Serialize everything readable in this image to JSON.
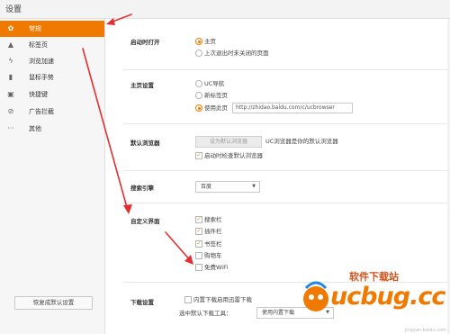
{
  "window": {
    "title": "设置"
  },
  "sidebar": {
    "items": [
      {
        "label": "常规",
        "icon": "gear-icon",
        "active": true
      },
      {
        "label": "标签页",
        "icon": "tab-icon"
      },
      {
        "label": "浏览加速",
        "icon": "lightning-icon"
      },
      {
        "label": "鼠标手势",
        "icon": "mouse-icon"
      },
      {
        "label": "快捷键",
        "icon": "keyboard-icon"
      },
      {
        "label": "广告拦截",
        "icon": "block-icon"
      },
      {
        "label": "其他",
        "icon": "more-icon"
      }
    ],
    "restore_label": "恢复成默认设置"
  },
  "sections": {
    "startup": {
      "title": "启动时打开",
      "options": [
        "主页",
        "上次退出时未关闭的页面"
      ]
    },
    "homepage": {
      "title": "主页设置",
      "options": [
        "UC导航",
        "新标签页",
        "使用此页"
      ],
      "url_value": "http://zhidao.baidu.com/c/ucbrowser"
    },
    "default_browser": {
      "title": "默认浏览器",
      "button_label": "设为默认浏览器",
      "status": "UC浏览器是你的默认浏览器",
      "check_label": "启动时检查默认浏览器"
    },
    "search": {
      "title": "搜索引擎",
      "selected": "百度"
    },
    "custom_ui": {
      "title": "自定义界面",
      "options": [
        "搜索栏",
        "插件栏",
        "书签栏",
        "购物车",
        "免费WiFi"
      ]
    },
    "download": {
      "title": "下载设置",
      "option": "内置下载启用迅雷下载",
      "tool_label": "选中默认下载工具：",
      "tool_selected": "使用内置下载"
    }
  },
  "watermark": {
    "slogan": "软件下载站",
    "url": "ucbug.cc",
    "small": "jingyan.baidu.com"
  },
  "colors": {
    "accent": "#f07a00",
    "arrow": "#e03030"
  }
}
